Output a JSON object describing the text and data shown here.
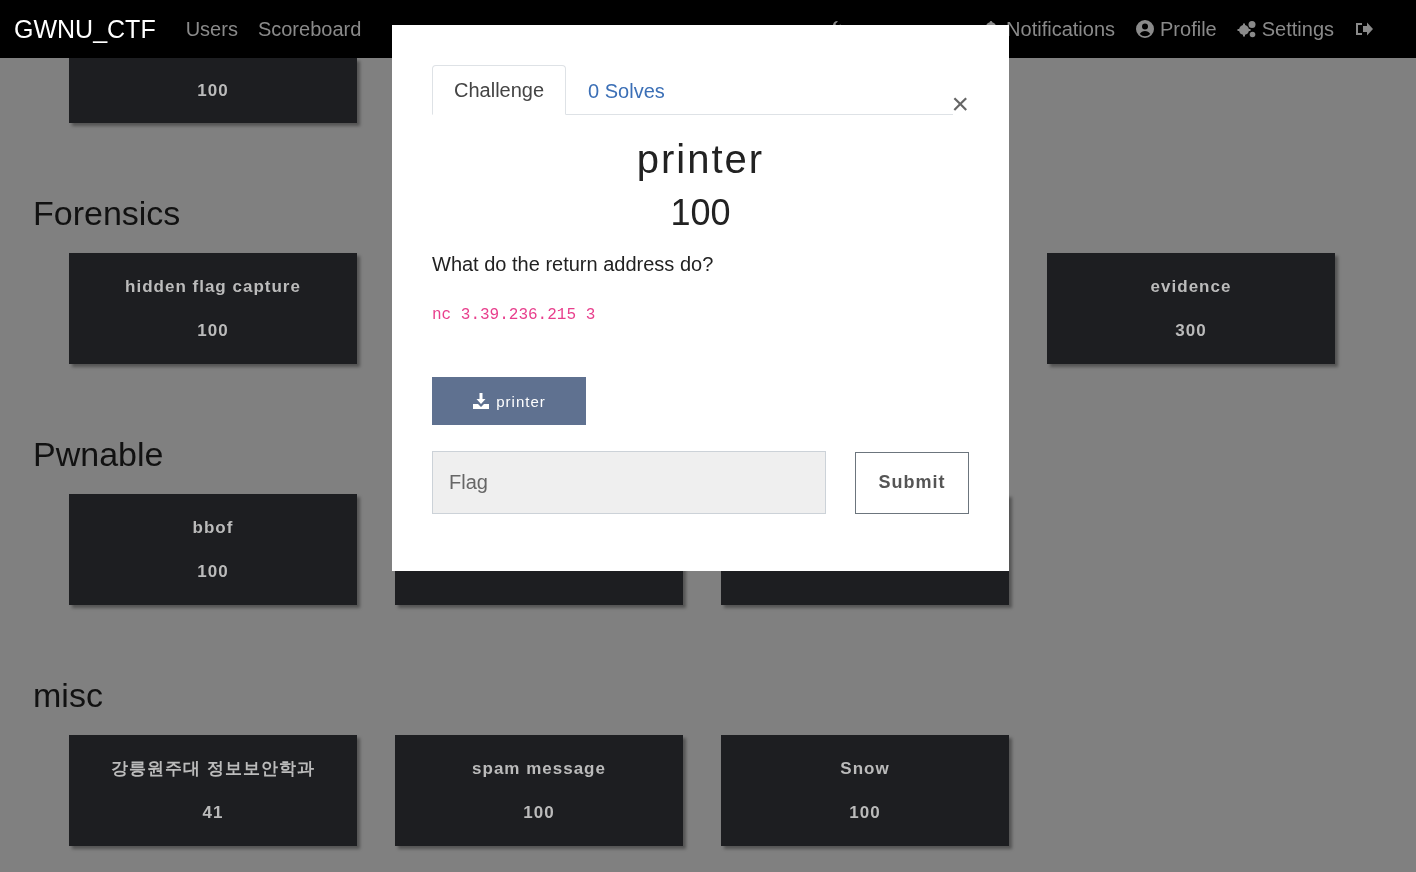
{
  "navbar": {
    "brand": "GWNU_CTF",
    "links": [
      "Users",
      "Scoreboard"
    ],
    "right_links": [
      {
        "kind": "covered"
      },
      {
        "kind": "labeled",
        "label": "Notifications"
      },
      {
        "kind": "labeled",
        "label": "Profile"
      },
      {
        "kind": "labeled",
        "label": "Settings"
      },
      {
        "kind": "icon_only"
      }
    ]
  },
  "categories": [
    {
      "cards": [
        {
          "kind": "cut",
          "value": "100"
        }
      ]
    },
    {
      "title": "Forensics",
      "cards": [
        {
          "kind": "full",
          "name": "hidden flag capture",
          "value": "100"
        },
        {
          "kind": "hidden"
        },
        {
          "kind": "hidden"
        },
        {
          "kind": "full",
          "name": "evidence",
          "value": "300"
        }
      ]
    },
    {
      "title": "Pwnable",
      "cards": [
        {
          "kind": "full",
          "name": "bbof",
          "value": "100"
        },
        {
          "kind": "covered"
        },
        {
          "kind": "covered"
        }
      ]
    },
    {
      "title": "misc",
      "cards": [
        {
          "kind": "full",
          "name": "강릉원주대 정보보안학과",
          "value": "41"
        },
        {
          "kind": "full",
          "name": "spam message",
          "value": "100"
        },
        {
          "kind": "full",
          "name": "Snow",
          "value": "100"
        }
      ]
    }
  ],
  "modal": {
    "tabs": [
      {
        "label": "Challenge",
        "selected": true
      },
      {
        "label": "0 Solves",
        "selected": false
      }
    ],
    "close": "×",
    "title": "printer",
    "value": "100",
    "description": "What do the return address do?",
    "code": "nc 3.39.236.215 3",
    "file_button": "printer",
    "flag": {
      "placeholder": "Flag"
    },
    "submit": "Submit"
  }
}
